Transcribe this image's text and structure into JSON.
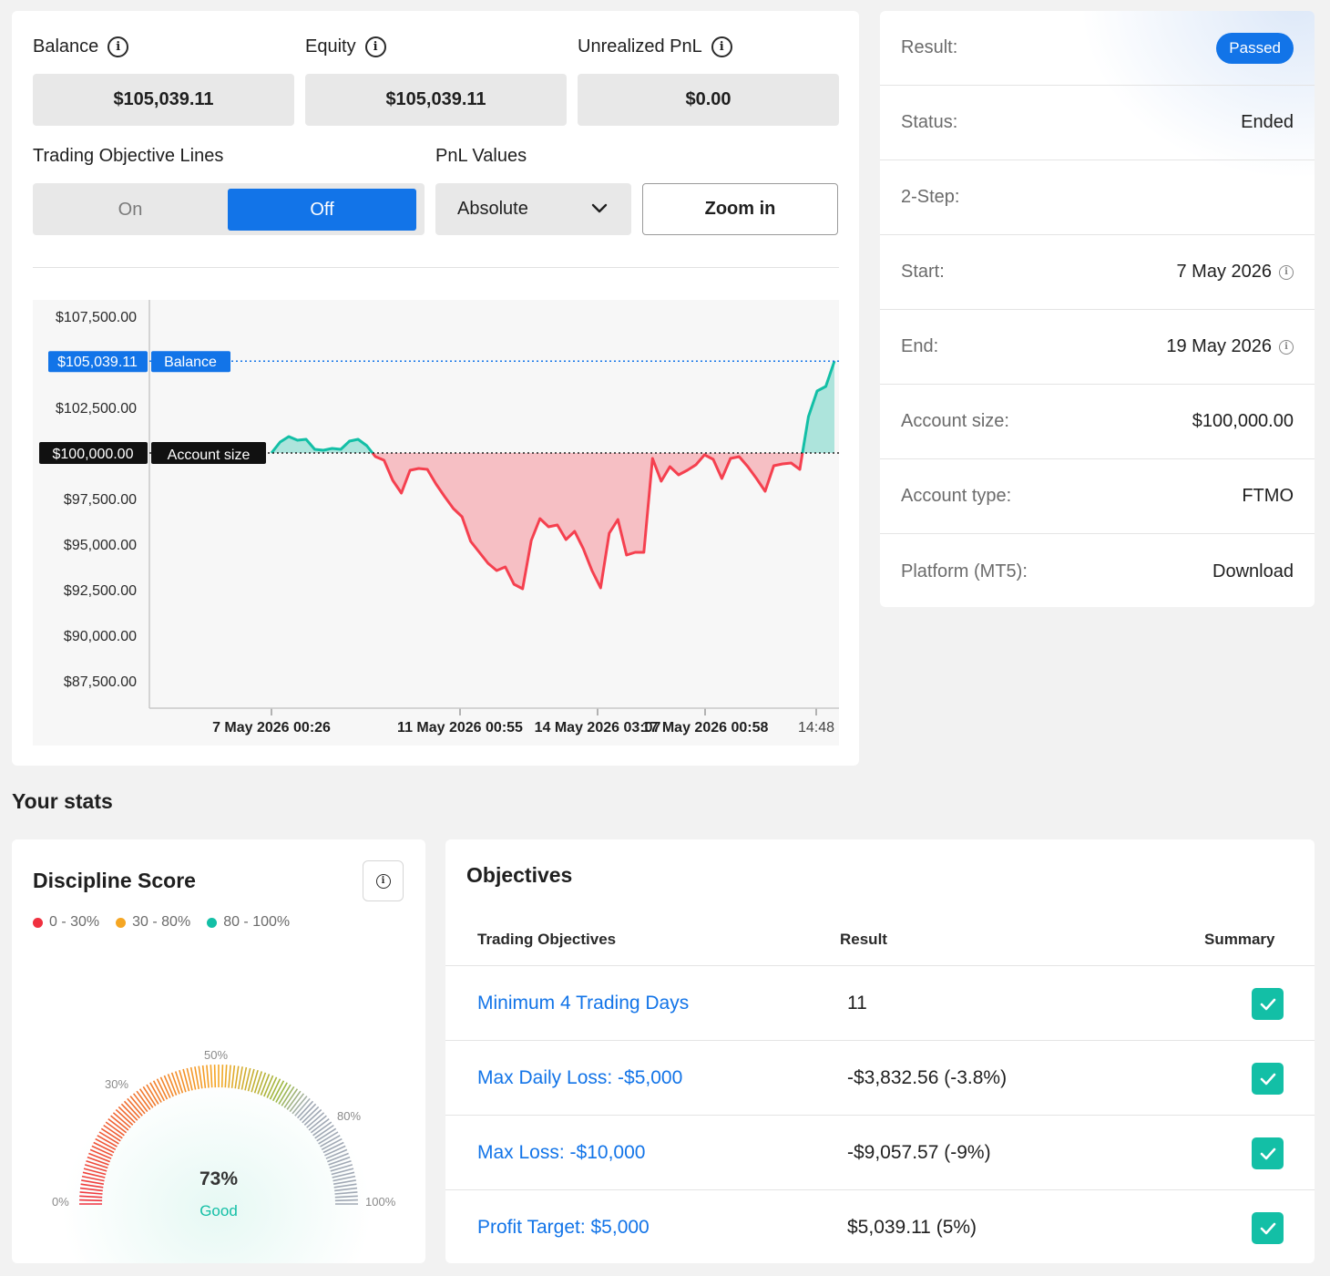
{
  "metrics": {
    "balance": {
      "label": "Balance",
      "value": "$105,039.11"
    },
    "equity": {
      "label": "Equity",
      "value": "$105,039.11"
    },
    "unrealized": {
      "label": "Unrealized PnL",
      "value": "$0.00"
    }
  },
  "controls": {
    "objective_lines_label": "Trading Objective Lines",
    "on_label": "On",
    "off_label": "Off",
    "selected_toggle": "Off",
    "pnl_label": "PnL Values",
    "pnl_select_value": "Absolute",
    "zoom_label": "Zoom in"
  },
  "chart_data": {
    "type": "area",
    "y_ticks": [
      "$107,500.00",
      "$102,500.00",
      "$97,500.00",
      "$95,000.00",
      "$92,500.00",
      "$90,000.00",
      "$87,500.00"
    ],
    "x_ticks": [
      "7 May 2026 00:26",
      "11 May 2026 00:55",
      "14 May 2026 03:07",
      "17 May 2026 00:58",
      "14:48"
    ],
    "balance_marker": {
      "value_label": "$105,039.11",
      "name": "Balance"
    },
    "account_marker": {
      "value_label": "$100,000.00",
      "name": "Account size"
    },
    "baseline": 100000,
    "ylim": [
      86000,
      108400
    ],
    "series": [
      {
        "values": [
          100000,
          100600,
          100900,
          100700,
          100750,
          100200,
          100150,
          100250,
          100200,
          100650,
          100750,
          100400,
          99800,
          99600,
          98500,
          97800,
          99050,
          99150,
          99100,
          98300,
          97600,
          96950,
          96500,
          95150,
          94550,
          93950,
          93550,
          93750,
          92800,
          92550,
          95200,
          96400,
          95950,
          96050,
          95250,
          95700,
          94750,
          93550,
          92600,
          95600,
          96350,
          94400,
          94550,
          94550,
          99700,
          98450,
          99250,
          98800,
          99050,
          99350,
          99900,
          99650,
          98600,
          99700,
          99800,
          99250,
          98600,
          97900,
          99300,
          99400,
          99450,
          99100,
          102000,
          103400,
          103650,
          105039.11
        ]
      }
    ]
  },
  "account": {
    "rows": [
      {
        "key": "Result:",
        "value": "Passed"
      },
      {
        "key": "Status:",
        "value": "Ended"
      },
      {
        "key": "2-Step:",
        "value": ""
      },
      {
        "key": "Start:",
        "value": "7 May 2026"
      },
      {
        "key": "End:",
        "value": "19 May 2026"
      },
      {
        "key": "Account size:",
        "value": "$100,000.00"
      },
      {
        "key": "Account type:",
        "value": "FTMO"
      },
      {
        "key": "Platform (MT5):",
        "value": "Download"
      }
    ]
  },
  "stats": {
    "title": "Your stats",
    "discipline": {
      "title": "Discipline Score",
      "legend": [
        "0 - 30%",
        "30 - 80%",
        "80 - 100%"
      ],
      "legend_colors": [
        "#f0303f",
        "#f5a623",
        "#13bfa6"
      ],
      "score": 0.73,
      "score_label": "73%",
      "rating": "Good",
      "gauge_labels": [
        "0%",
        "30%",
        "50%",
        "80%",
        "100%"
      ]
    },
    "objectives": {
      "title": "Objectives",
      "headers": [
        "Trading Objectives",
        "Result",
        "Summary"
      ],
      "rows": [
        {
          "name": "Minimum 4 Trading Days",
          "result": "11"
        },
        {
          "name": "Max Daily Loss: -$5,000",
          "result": "-$3,832.56 (-3.8%)"
        },
        {
          "name": "Max Loss: -$10,000",
          "result": "-$9,057.57 (-9%)"
        },
        {
          "name": "Profit Target: $5,000",
          "result": "$5,039.11 (5%)"
        }
      ]
    }
  },
  "colors": {
    "accent": "#1274e8",
    "teal": "#13bfa6",
    "red": "#f5404f"
  }
}
